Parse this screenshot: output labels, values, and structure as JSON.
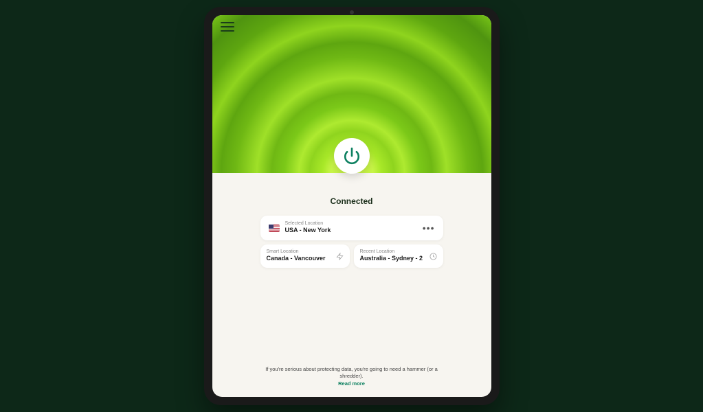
{
  "status": "Connected",
  "selected": {
    "label": "Selected Location",
    "value": "USA - New York",
    "flag": "us"
  },
  "smart": {
    "label": "Smart Location",
    "value": "Canada - Vancouver"
  },
  "recent": {
    "label": "Recent Location",
    "value": "Australia - Sydney - 2"
  },
  "tip": {
    "text": "If you're serious about protecting data, you're going to need a hammer (or a shredder).",
    "link": "Read more"
  },
  "colors": {
    "accent_green": "#0d8060",
    "hero_green": "#8fd41e"
  }
}
